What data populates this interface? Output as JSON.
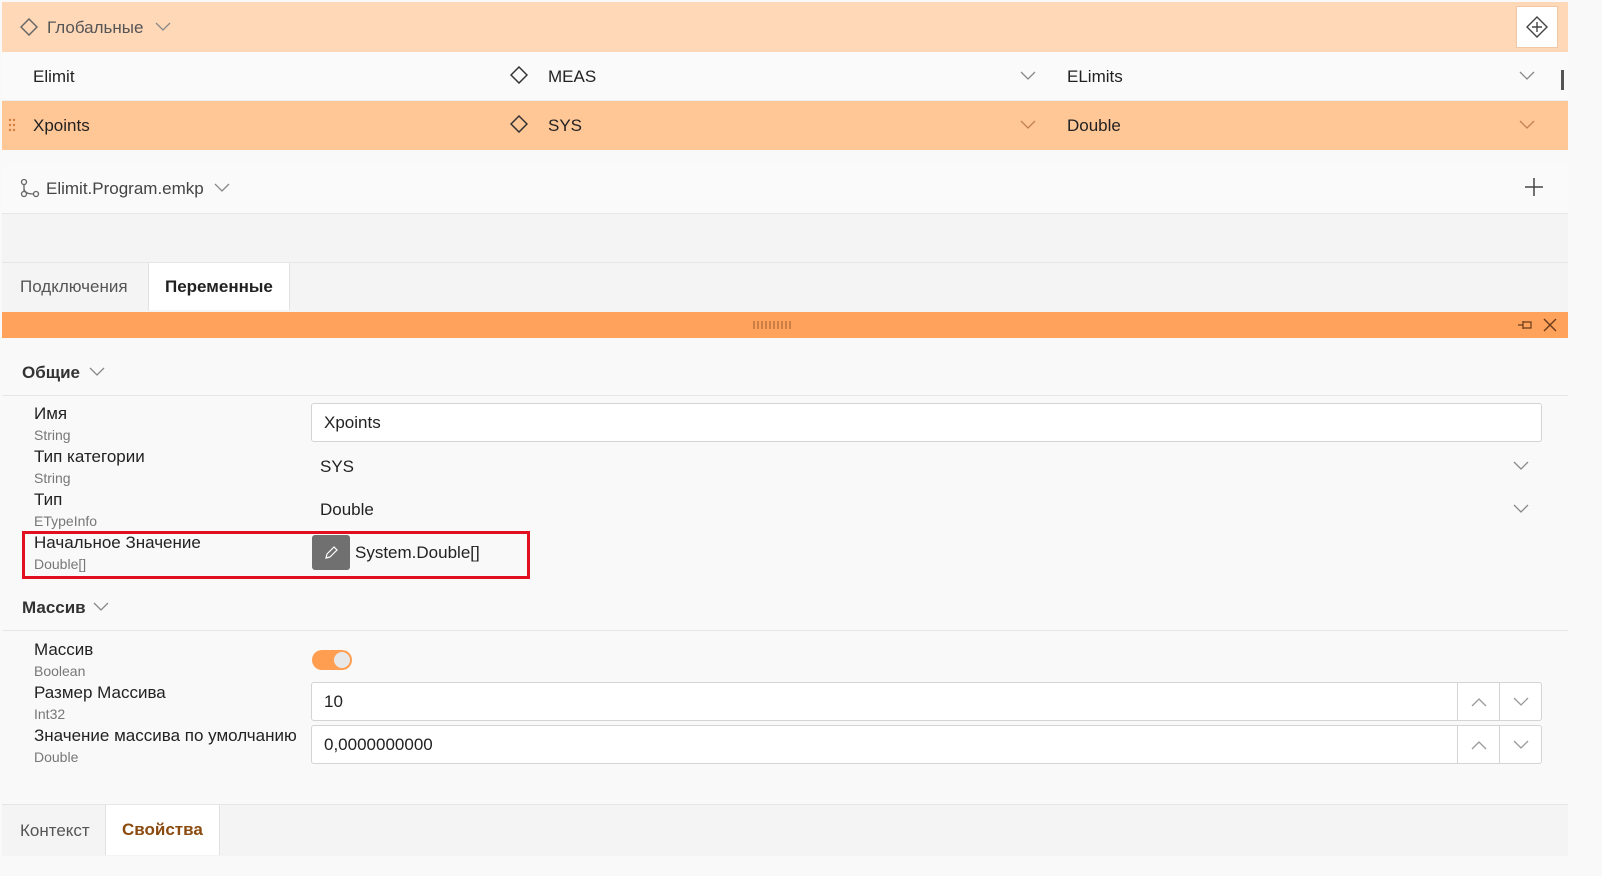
{
  "globals": {
    "label": "Глобальные"
  },
  "variables_table": {
    "rows": [
      {
        "name": "Elimit",
        "category": "MEAS",
        "type": "ELimits"
      },
      {
        "name": "Xpoints",
        "category": "SYS",
        "type": "Double"
      }
    ]
  },
  "program_file": {
    "label": "Elimit.Program.emkp"
  },
  "upper_tabs": [
    {
      "label": "Подключения"
    },
    {
      "label": "Переменные"
    }
  ],
  "sections": {
    "general": {
      "title": "Общие",
      "props": [
        {
          "name": "Имя",
          "type": "String",
          "value": "Xpoints"
        },
        {
          "name": "Тип категории",
          "type": "String",
          "value": "SYS"
        },
        {
          "name": "Тип",
          "type": "ETypeInfo",
          "value": "Double"
        },
        {
          "name": "Начальное Значение",
          "type": "Double[]",
          "value": "System.Double[]"
        }
      ]
    },
    "array": {
      "title": "Массив",
      "props": [
        {
          "name": "Массив",
          "type": "Boolean",
          "value": true
        },
        {
          "name": "Размер Массива",
          "type": "Int32",
          "value": "10"
        },
        {
          "name": "Значение массива по умолчанию",
          "type": "Double",
          "value": "0,0000000000"
        }
      ]
    }
  },
  "bottom_tabs": [
    {
      "label": "Контекст"
    },
    {
      "label": "Свойства"
    }
  ],
  "colors": {
    "accent": "#ffa35c",
    "selected_row": "#ffc696",
    "header_bg": "#ffd8b8",
    "highlight_border": "#e01020",
    "active_bottom_tab_text": "#8a4a10"
  },
  "icons": [
    "diamond-icon",
    "crosshair-icon",
    "chevron-down-icon",
    "drag-handle-icon",
    "branch-icon",
    "plus-icon",
    "pin-icon",
    "close-icon",
    "pencil-icon",
    "chevron-up-icon"
  ]
}
